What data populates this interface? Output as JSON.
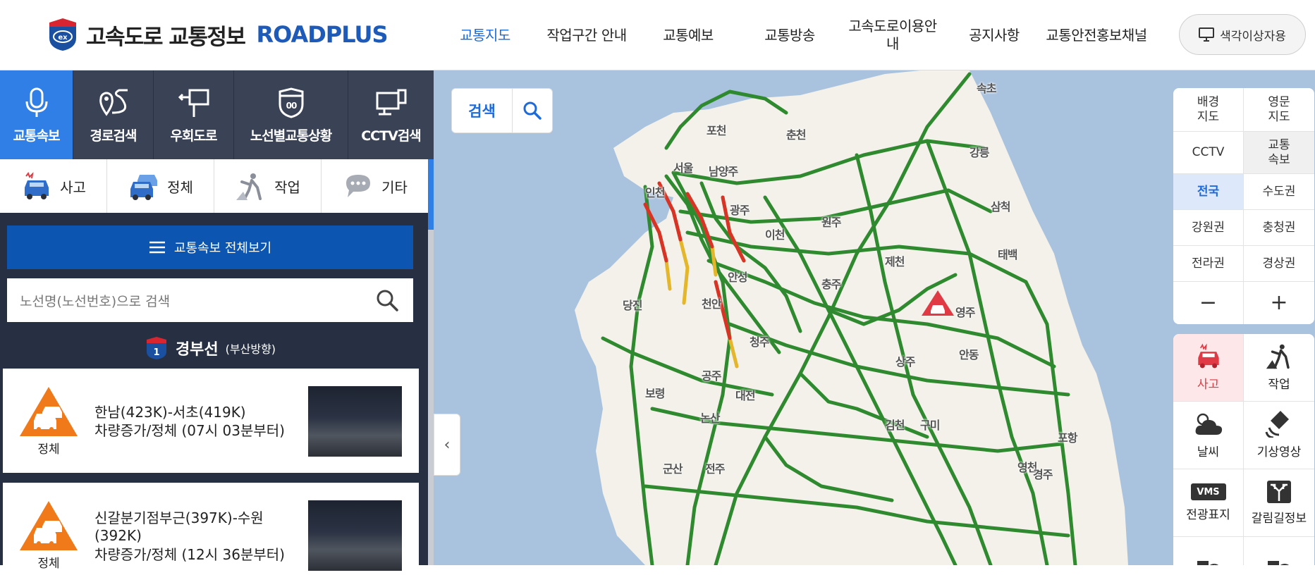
{
  "header": {
    "logo_ko": "고속도로 교통정보",
    "logo_en": "ROADPLUS",
    "nav": [
      {
        "label": "교통지도",
        "active": true
      },
      {
        "label": "작업구간 안내"
      },
      {
        "label": "교통예보"
      },
      {
        "label": "교통방송"
      },
      {
        "label": "고속도로이용안내"
      },
      {
        "label": "공지사항"
      },
      {
        "label": "교통안전홍보채널"
      }
    ],
    "color_button": "색각이상자용"
  },
  "sidebar": {
    "tabs": [
      {
        "label": "교통속보",
        "icon": "microphone-icon",
        "active": true
      },
      {
        "label": "경로검색",
        "icon": "route-icon"
      },
      {
        "label": "우회도로",
        "icon": "detour-sign-icon"
      },
      {
        "label": "노선별교통상황",
        "icon": "highway-shield-icon"
      },
      {
        "label": "CCTV검색",
        "icon": "cctv-monitor-icon"
      }
    ],
    "categories": [
      {
        "label": "사고",
        "icon": "accident-car-icon"
      },
      {
        "label": "정체",
        "icon": "congestion-cars-icon"
      },
      {
        "label": "작업",
        "icon": "roadwork-icon"
      },
      {
        "label": "기타",
        "icon": "chat-bubble-icon"
      }
    ],
    "view_all": "교통속보 전체보기",
    "search_placeholder": "노선명(노선번호)으로 검색",
    "route": {
      "number": "1",
      "name": "경부선",
      "direction": "(부산방향)"
    },
    "cards": [
      {
        "type": "정체",
        "line1": "한남(423K)-서초(419K)",
        "line2": "차량증가/정체 (07시 03분부터)"
      },
      {
        "type": "정체",
        "line1": "신갈분기점부근(397K)-수원(392K)",
        "line2": "차량증가/정체 (12시 36분부터)"
      }
    ]
  },
  "map": {
    "search_label": "검색",
    "collapse_glyph": "‹",
    "controls": [
      [
        "배경\n지도",
        "영문\n지도"
      ],
      [
        "CCTV",
        "교통\n속보"
      ],
      [
        "전국",
        "수도권"
      ],
      [
        "강원권",
        "충청권"
      ],
      [
        "전라권",
        "경상권"
      ],
      [
        "−",
        "+"
      ]
    ],
    "layers": [
      [
        "사고",
        "작업"
      ],
      [
        "날씨",
        "기상영상"
      ],
      [
        "전광표지",
        "갈림길정보"
      ]
    ],
    "vms_badge": "VMS",
    "cities": [
      "속초",
      "포천",
      "춘천",
      "강릉",
      "서울",
      "남양주",
      "인천",
      "광주",
      "원주",
      "삼척",
      "이천",
      "제천",
      "태백",
      "안성",
      "충주",
      "당진",
      "천안",
      "영주",
      "청주",
      "안동",
      "공주",
      "대전",
      "상주",
      "보령",
      "논산",
      "김천",
      "구미",
      "포항",
      "군산",
      "전주",
      "영천",
      "경주"
    ],
    "colors": {
      "smooth": "#2f8a2f",
      "slow": "#e3b62b",
      "jam": "#d73327",
      "accent": "#2f7fe6"
    }
  }
}
